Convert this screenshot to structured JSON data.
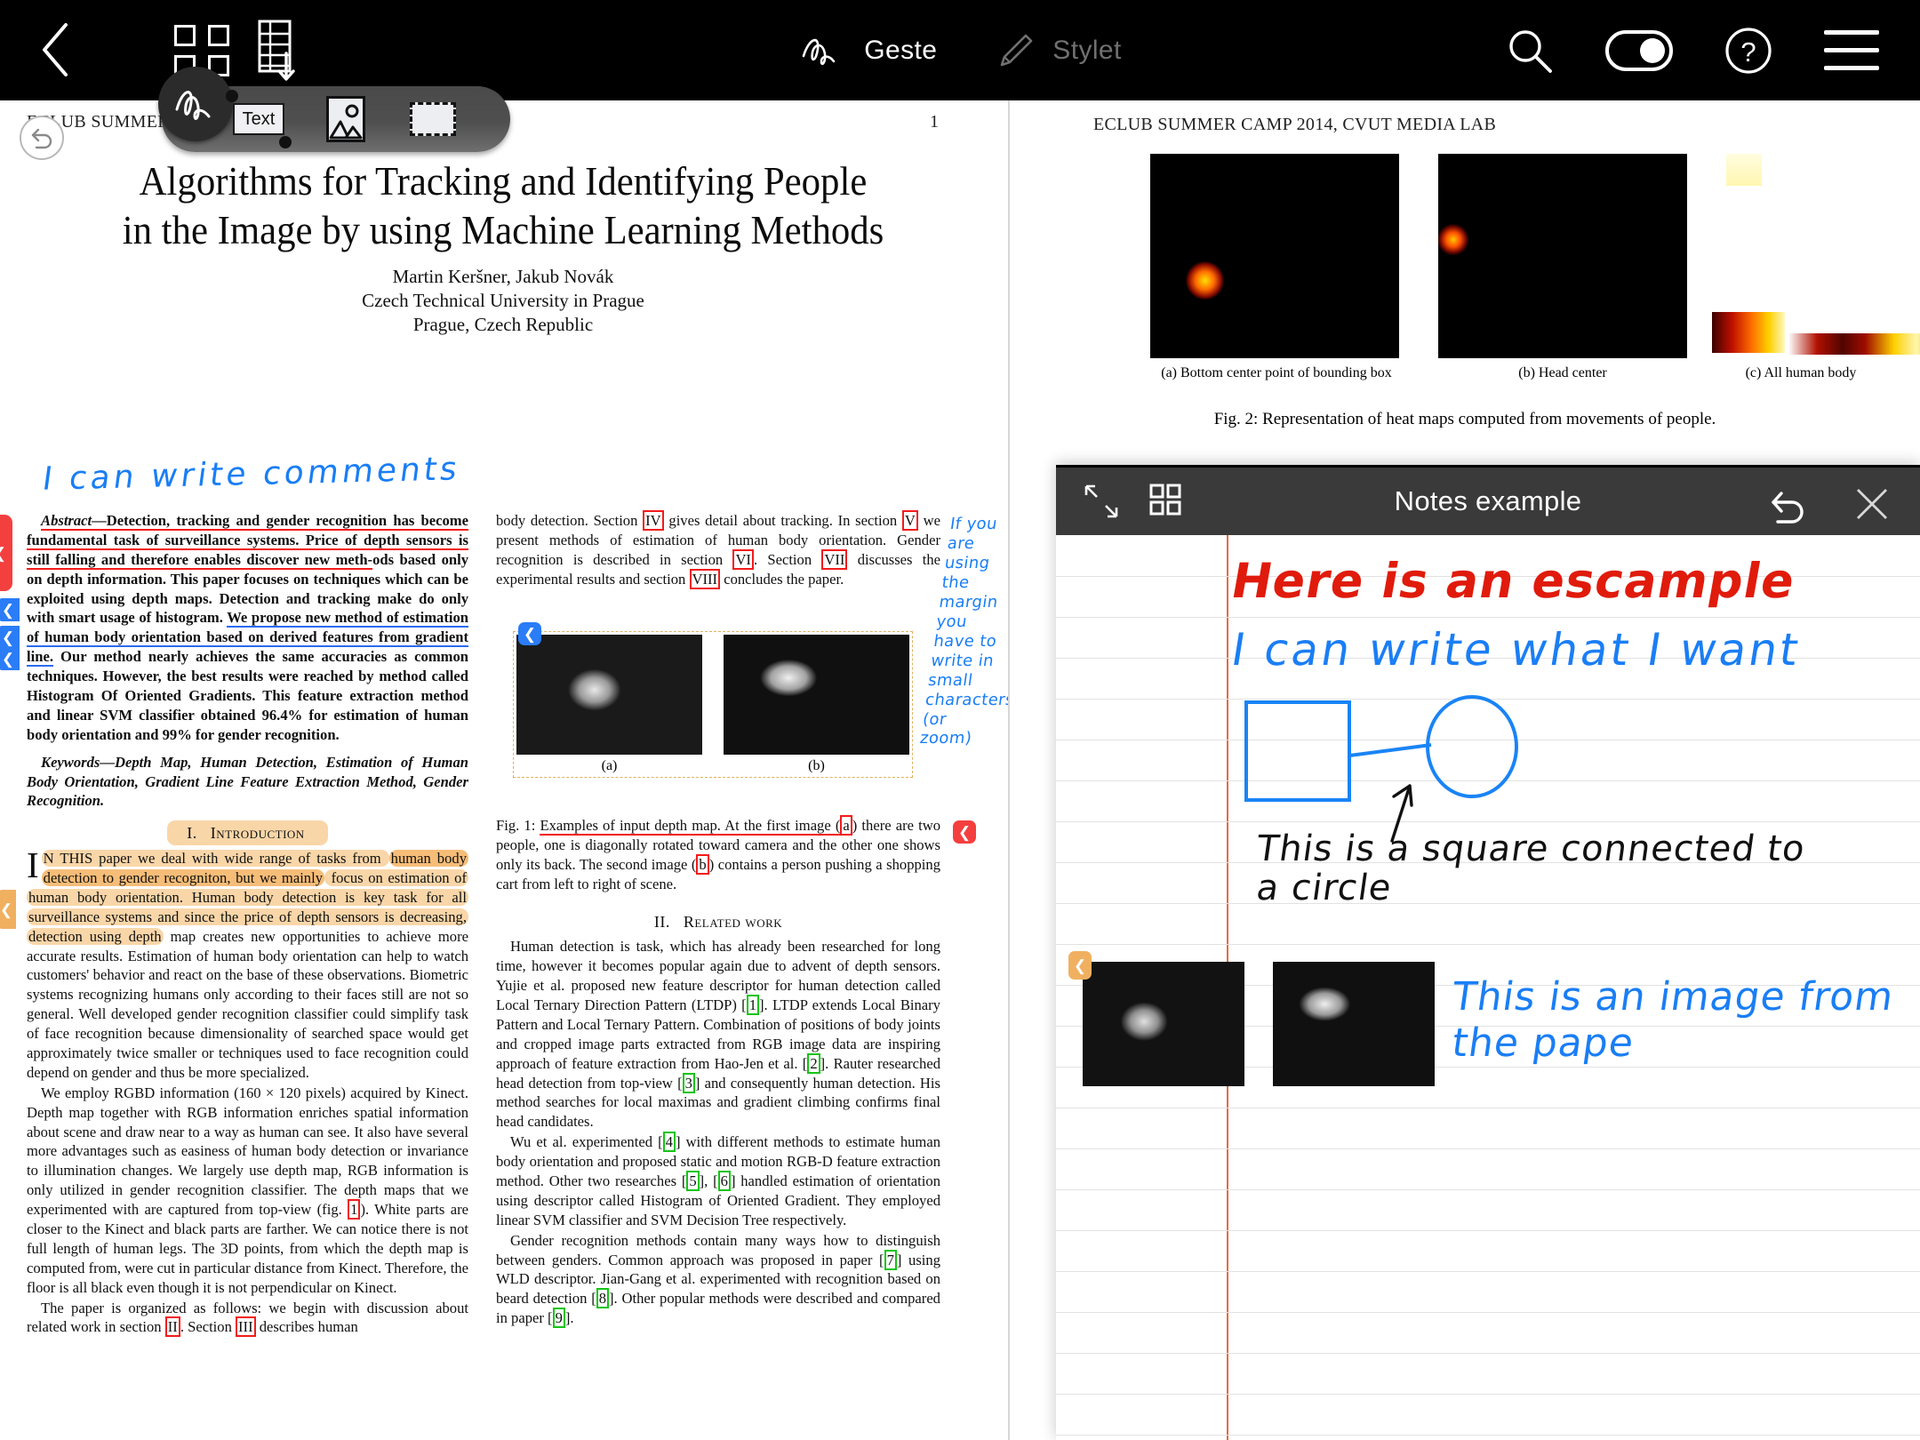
{
  "topbar": {
    "back_icon": "chevron-left-icon",
    "grid_icon": "grid-view-icon",
    "export_icon": "export-page-icon",
    "modes": [
      {
        "label": "Geste",
        "icon": "scribble-icon",
        "active": true
      },
      {
        "label": "Stylet",
        "icon": "pencil-icon",
        "active": false
      }
    ],
    "right_icons": [
      "search-icon",
      "night-mode-toggle",
      "help-icon",
      "hamburger-menu-icon"
    ],
    "toggle_state": "on"
  },
  "palette": {
    "selected": "scribble-tool",
    "items": [
      {
        "name": "text-tool",
        "label": "Text"
      },
      {
        "name": "image-tool",
        "label": ""
      },
      {
        "name": "selection-tool",
        "label": ""
      }
    ]
  },
  "undo_button": {
    "icon": "undo-icon"
  },
  "left_page": {
    "running_head": "ECLUB SUMMER CAMP 2014, CVUT MEDIA LAB",
    "page_number": "1",
    "title_line1": "Algorithms for Tracking and Identifying People",
    "title_line2": "in the Image by using Machine Learning Methods",
    "authors": "Martin Keršner, Jakub Novák",
    "affiliation": "Czech Technical University in Prague",
    "location": "Prague, Czech Republic",
    "handwriting_top": "I can write comments",
    "abstract": {
      "label": "Abstract",
      "red_part": "—Detection, tracking and gender recognition has become fundamental task of surveillance systems. Price of depth sensors is still falling and therefore enables discover new meth-",
      "mid_part": "ods based only on depth information. This paper focuses on techniques which can be exploited using depth maps. Detection and tracking make do only with smart usage of histogram. ",
      "blue_part": "We propose new method of estimation of human body orientation based on derived features from gradient line.",
      "tail_part": " Our method nearly achieves the same accuracies as common techniques. However, the best results were reached by method called Histogram Of Oriented Gradients. This feature extraction method and linear SVM classifier obtained 96.4% for estimation of human body orientation and 99% for gender recognition."
    },
    "keywords": "Keywords—Depth Map, Human Detection, Estimation of Human Body Orientation, Gradient Line Feature Extraction Method, Gender Recognition.",
    "section1_num": "I.",
    "section1_title": "Introduction",
    "intro_hl1": "N THIS paper we deal with wide range of tasks from ",
    "intro_hl2": "human body detection to gender recogniton, but we mainly",
    "intro_hl3": " focus on estimation of human body orientation. Human body detection is key task for all surveillance systems and since the price of depth sensors is decreasing, detection using depth",
    "intro_rest": " map creates new opportunities to achieve more accurate results. Estimation of human body orientation can help to watch customers' behavior and react on the base of these observations. Biometric systems recognizing humans only according to their faces still are not so general. Well developed gender recognition classifier could simplify task of face recognition because dimensionality of searched space would get approximately twice smaller or techniques used to face recognition could depend on gender and thus be more specialized.",
    "para2": "We employ RGBD information (160 × 120 pixels) acquired by Kinect. Depth map together with RGB information enriches spatial information about scene and draw near to a way as human can see. It also have several more advantages such as easiness of human body detection or invariance to illumination changes. We largely use depth map, RGB information is only utilized in gender recognition classifier. The depth maps that we experimented with are captured from top-view (fig. ",
    "para2_ref": "1",
    "para2_tail": "). White parts are closer to the Kinect and black parts are farther. We can notice there is not full length of human legs. The 3D points, from which the depth map is computed from, were cut in particular distance from Kinect. Therefore, the floor is all black even though it is not perpendicular on Kinect.",
    "para3_a": "The paper is organized as follows: we begin with discussion about related work in section ",
    "para3_ref1": "II",
    "para3_b": ". Section ",
    "para3_ref2": "III",
    "para3_c": " describes human"
  },
  "middle_col": {
    "p1_a": "body detection. Section ",
    "p1_ref1": "IV",
    "p1_b": " gives detail about tracking. In section ",
    "p1_ref2": "V",
    "p1_c": " we present methods of estimation of human body orientation. Gender recognition is described in section ",
    "p1_ref3": "VI",
    "p1_d": ". Section ",
    "p1_ref4": "VII",
    "p1_e": " discusses the experimental results and section ",
    "p1_ref5": "VIII",
    "p1_f": " concludes the paper.",
    "handwriting_margin": "If you are using the margin you have to write in small characters (or zoom)",
    "fig1_label": "Fig. 1: ",
    "fig1_underlined": "Examples of input depth map. At the first image (",
    "fig1_ref_a": "a",
    "fig1_mid": ") there are two people, one is diagonally rotated toward camera and the other one shows only its back. The second image (",
    "fig1_ref_b": "b",
    "fig1_tail": ") contains a person pushing a shopping cart from left to right of scene.",
    "subcap_a": "(a)",
    "subcap_b": "(b)",
    "section2_num": "II.",
    "section2_title": "Related work",
    "rw_p1_a": "Human detection is task, which has already been researched for long time, however it becomes popular again due to advent of depth sensors. Yujie et al. proposed new feature descriptor for human detection called Local Ternary Direction Pattern (LTDP) [",
    "rw_ref1": "1",
    "rw_p1_b": "]. LTDP extends Local Binary Pattern and Local Ternary Pattern. Combination of positions of body joints and cropped image parts extracted from RGB image data are inspiring approach of feature extraction from Hao-Jen et al. [",
    "rw_ref2": "2",
    "rw_p1_c": "]. Rauter researched head detection from top-view [",
    "rw_ref3": "3",
    "rw_p1_d": "] and consequently human detection. His method searches for local maximas and gradient climbing confirms final head candidates.",
    "rw_p2_a": "Wu et al. experimented [",
    "rw_ref4": "4",
    "rw_p2_b": "] with different methods to estimate human body orientation and proposed static and motion RGB-D feature extraction method. Other two researches [",
    "rw_ref5": "5",
    "rw_p2_c": "], [",
    "rw_ref6": "6",
    "rw_p2_d": "] handled estimation of orientation using descriptor called Histogram of Oriented Gradient. They employed linear SVM classifier and SVM Decision Tree respectively.",
    "rw_p3_a": "Gender recognition methods contain many ways how to distinguish between genders. Common approach was proposed in paper [",
    "rw_ref7": "7",
    "rw_p3_b": "] using WLD descriptor. Jian-Gang et al. experimented with recognition based on beard detection [",
    "rw_ref8": "8",
    "rw_p3_c": "]. Other popular methods were described and compared in paper [",
    "rw_ref9": "9",
    "rw_p3_d": "]."
  },
  "right_page": {
    "running_head": "ECLUB SUMMER CAMP 2014, CVUT MEDIA LAB",
    "heatmap_caption_a": "(a) Bottom center point of bounding box",
    "heatmap_caption_b": "(b) Head center",
    "heatmap_caption_c": "(c) All human body",
    "fig2_caption": "Fig. 2: Representation of heat maps computed from movements of people."
  },
  "notes_panel": {
    "title": "Notes example",
    "icons": {
      "resize": "resize-diagonal-icon",
      "grid": "grid-view-icon",
      "undo": "undo-icon",
      "close": "close-icon"
    },
    "line_red": "Here is an escample",
    "line_blue": "I can write what I want",
    "diagram_caption_l1": "This is a square connected to",
    "diagram_caption_l2": "a circle",
    "image_caption_l1": "This is an image from",
    "image_caption_l2": "the pape"
  },
  "colors": {
    "topbar_bg": "#000000",
    "accent_red": "#f21b1b",
    "accent_blue": "#2a6bf2",
    "highlight_orange": "#f9d6a8",
    "marker_blue": "#2a7cf7",
    "marker_red": "#f43f3f",
    "notes_header": "#3a3a3a",
    "notes_margin_line": "#e86a3f",
    "hand_blue": "#1a7ef5",
    "hand_red": "#e01b0c"
  }
}
